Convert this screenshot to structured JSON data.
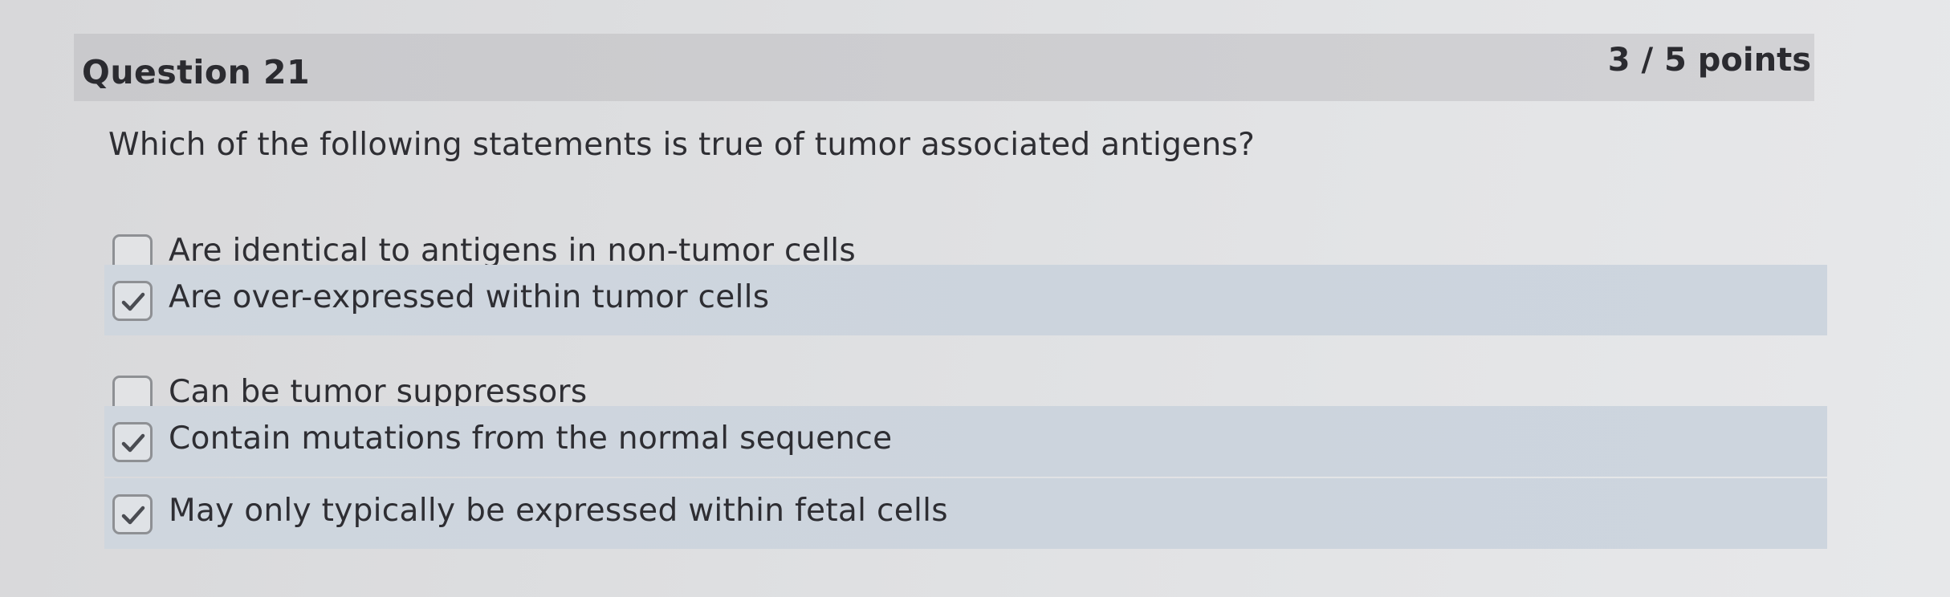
{
  "question": {
    "title": "Question 21",
    "points": "3 / 5 points",
    "prompt": "Which of the following statements is true of tumor associated antigens?"
  },
  "answers": [
    {
      "label": "Are identical to antigens in non-tumor cells",
      "checked": false
    },
    {
      "label": "Are over-expressed within tumor cells",
      "checked": true
    },
    {
      "label": "Can be tumor suppressors",
      "checked": false
    },
    {
      "label": "Contain mutations from the normal sequence",
      "checked": true
    },
    {
      "label": "May only typically be expressed within fetal cells",
      "checked": true
    }
  ],
  "colors": {
    "header_bar": "#cbcbce",
    "selected_row": "#cdd5de",
    "text": "#2e2e33",
    "checkmark": "#4a4c52"
  }
}
